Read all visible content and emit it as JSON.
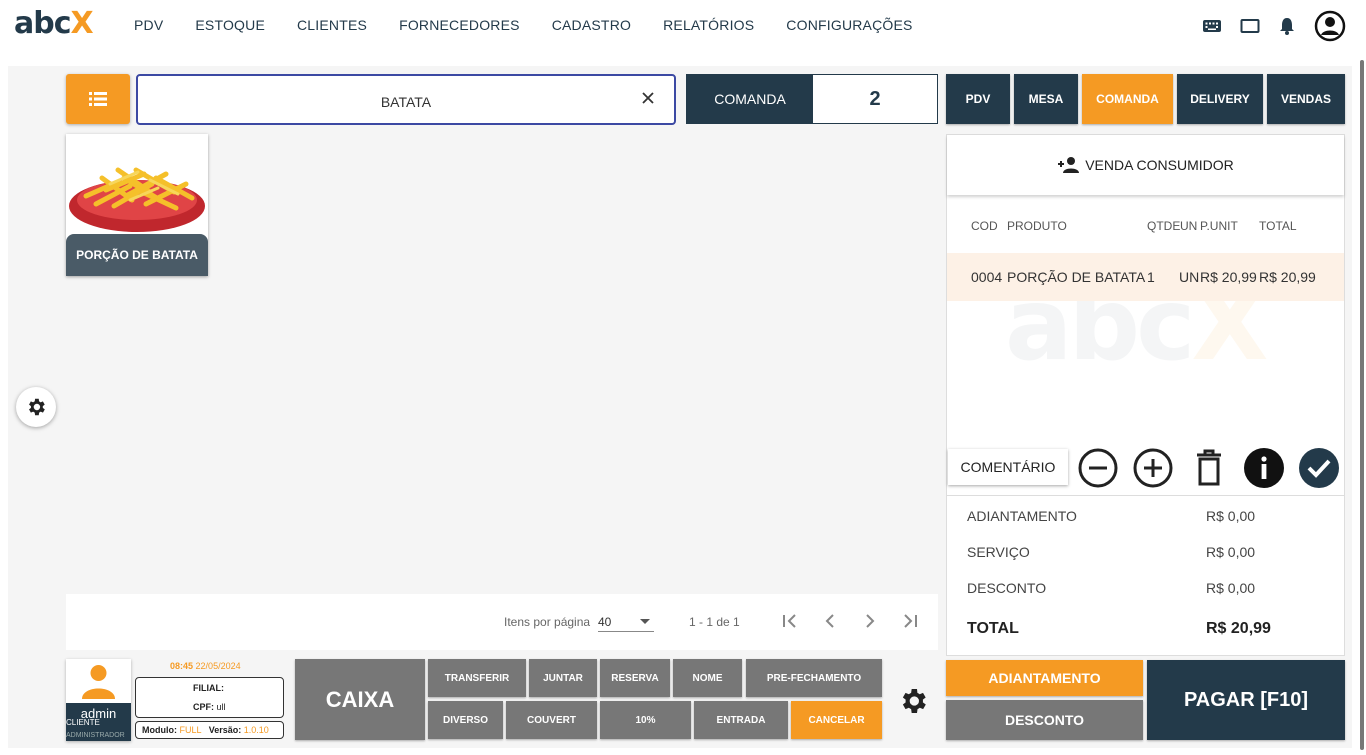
{
  "logo": {
    "part1": "abc",
    "part2": "X"
  },
  "nav": [
    "PDV",
    "ESTOQUE",
    "CLIENTES",
    "FORNECEDORES",
    "CADASTRO",
    "RELATÓRIOS",
    "CONFIGURAÇÕES"
  ],
  "search": {
    "value": "BATATA"
  },
  "comanda": {
    "label": "COMANDA",
    "number": "2"
  },
  "mode_tabs": [
    "PDV",
    "MESA",
    "COMANDA",
    "DELIVERY",
    "VENDAS"
  ],
  "product": {
    "name": "PORÇÃO DE BATATA"
  },
  "paginator": {
    "items_per_page_label": "Itens por página",
    "items_per_page": "40",
    "range": "1 - 1 de 1"
  },
  "cart": {
    "venda_consumidor": "VENDA CONSUMIDOR",
    "columns": [
      "COD",
      "PRODUTO",
      "QTDE",
      "UN",
      "P.UNIT",
      "TOTAL"
    ],
    "rows": [
      {
        "cod": "0004",
        "produto": "PORÇÃO DE BATATA",
        "qtde": "1",
        "un": "UN",
        "punit": "R$ 20,99",
        "total": "R$ 20,99"
      }
    ],
    "watermark": "abcX",
    "comentario": "COMENTÁRIO"
  },
  "totals": {
    "adiantamento_label": "ADIANTAMENTO",
    "adiantamento": "R$ 0,00",
    "servico_label": "SERVIÇO",
    "servico": "R$ 0,00",
    "desconto_label": "DESCONTO",
    "desconto": "R$ 0,00",
    "total_label": "TOTAL",
    "total": "R$ 20,99"
  },
  "buttons": {
    "adiantamento": "ADIANTAMENTO",
    "desconto": "DESCONTO",
    "pagar": "PAGAR [F10]",
    "caixa": "CAIXA",
    "transferir": "TRANSFERIR",
    "juntar": "JUNTAR",
    "reserva": "RESERVA",
    "nome": "NOME",
    "pre_fechamento": "PRE-FECHAMENTO",
    "diverso": "DIVERSO",
    "couvert": "COUVERT",
    "dez_pct": "10%",
    "entrada": "ENTRADA",
    "cancelar": "CANCELAR"
  },
  "user": {
    "name": "admin",
    "role": "CLIENTE",
    "role2": "ADMINISTRADOR",
    "time": "08:45",
    "date": "22/05/2024",
    "filial_label": "FILIAL:",
    "cpf_label": "CPF:",
    "cpf": "ull",
    "modulo_label": "Modulo:",
    "modulo": "FULL",
    "versao_label": "Versão:",
    "versao": "1.0.10"
  },
  "colors": {
    "navy": "#233a4a",
    "orange": "#f59a23",
    "gray": "#777777",
    "search_border": "#3c49a3"
  },
  "icons": [
    "keyboard-icon",
    "monitor-icon",
    "bell-icon",
    "account-circle-icon",
    "list-menu-icon",
    "close-icon",
    "gear-icon",
    "person-add-icon",
    "minus-circle-icon",
    "plus-circle-icon",
    "trash-icon",
    "info-icon",
    "check-circle-icon",
    "first-page-icon",
    "prev-page-icon",
    "next-page-icon",
    "last-page-icon"
  ]
}
